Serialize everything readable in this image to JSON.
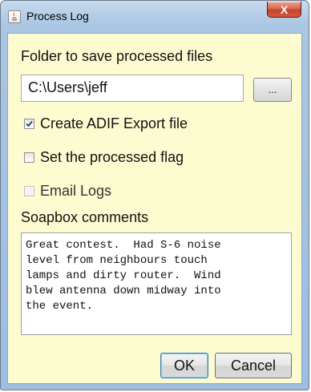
{
  "window": {
    "title": "Process Log",
    "close_symbol": "X"
  },
  "folder": {
    "label": "Folder to save processed files",
    "value": "C:\\Users\\jeff",
    "browse_label": "..."
  },
  "options": [
    {
      "label": "Create ADIF Export file",
      "checked": true,
      "enabled": true
    },
    {
      "label": "Set the processed flag",
      "checked": false,
      "enabled": true
    },
    {
      "label": "Email Logs",
      "checked": false,
      "enabled": false
    }
  ],
  "comments": {
    "label": "Soapbox comments",
    "text": "Great contest.  Had S-6 noise\nlevel from neighbours touch\nlamps and dirty router.  Wind\nblew antenna down midway into\nthe event."
  },
  "buttons": {
    "ok": "OK",
    "cancel": "Cancel"
  }
}
